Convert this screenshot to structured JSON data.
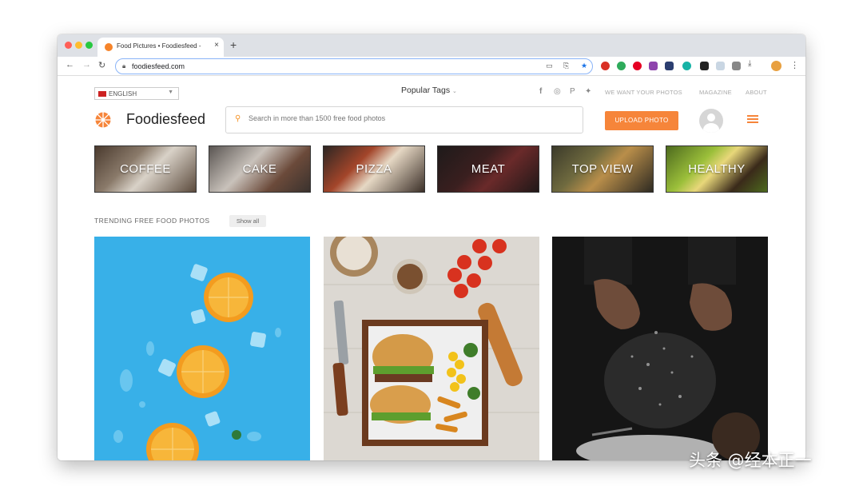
{
  "browser": {
    "tab_title": "Food Pictures • Foodiesfeed - ",
    "tab_close": "×",
    "new_tab": "+",
    "url": "foodiesfeed.com",
    "nav": {
      "back": "←",
      "forward": "→",
      "reload": "↻"
    },
    "bookmark_star": "★",
    "menu": "⋮"
  },
  "site": {
    "language": "ENGLISH",
    "popular_tags": "Popular Tags",
    "social": {
      "facebook": "f",
      "instagram": "◎",
      "pinterest": "P",
      "twitter": "✦"
    },
    "top_nav": [
      "WE WANT YOUR PHOTOS",
      "MAGAZINE",
      "ABOUT"
    ],
    "logo_text": "Foodiesfeed",
    "search_placeholder": "Search in more than 1500 free food photos",
    "upload_label": "UPLOAD PHOTO",
    "categories": [
      "COFFEE",
      "CAKE",
      "PIZZA",
      "MEAT",
      "TOP VIEW",
      "HEALTHY"
    ],
    "trending_title": "TRENDING FREE FOOD PHOTOS",
    "show_all": "Show all",
    "brand_color": "#f6853a"
  },
  "watermark": "头条 @经本正一"
}
